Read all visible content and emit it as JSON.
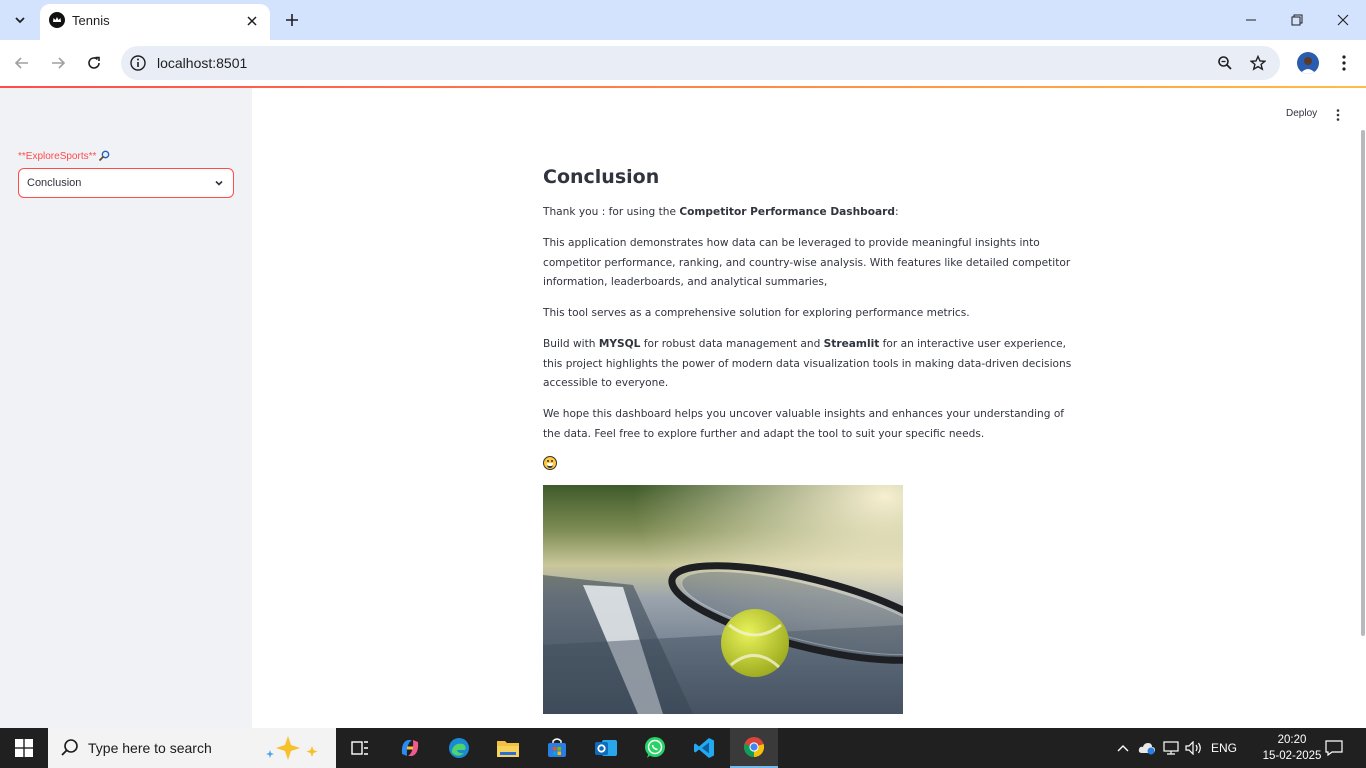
{
  "browser": {
    "tab_title": "Tennis",
    "url": "localhost:8501"
  },
  "app": {
    "deploy_label": "Deploy",
    "sidebar": {
      "label": "**ExploreSports**",
      "label_icon": "magnifier-emoji",
      "select_value": "Conclusion"
    },
    "main": {
      "heading": "Conclusion",
      "p1_pre": "Thank you : for using the ",
      "p1_bold": "Competitor Performance Dashboard",
      "p1_post": ":",
      "p2": "This application demonstrates how data can be leveraged to provide meaningful insights into competitor performance, ranking, and country-wise analysis. With features like detailed competitor information, leaderboards, and analytical summaries,",
      "p3": "This tool serves as a comprehensive solution for exploring performance metrics.",
      "p4_a": "Build with ",
      "p4_b": "MYSQL",
      "p4_c": " for robust data management and ",
      "p4_d": "Streamlit",
      "p4_e": " for an interactive user experience, this project highlights the power of modern data visualization tools in making data-driven decisions accessible to everyone.",
      "p5": "We hope this dashboard helps you uncover valuable insights and enhances your understanding of the data. Feel free to explore further and adapt the tool to suit your specific needs.",
      "emoji": "grinning-face",
      "image": "tennis-ball-and-racket-photo"
    },
    "colors": {
      "accent": "#ff4b4b",
      "sidebar_bg": "#f0f2f6",
      "text": "#31333f"
    }
  },
  "taskbar": {
    "search_placeholder": "Type here to search",
    "language": "ENG",
    "time": "20:20",
    "date": "15-02-2025"
  }
}
